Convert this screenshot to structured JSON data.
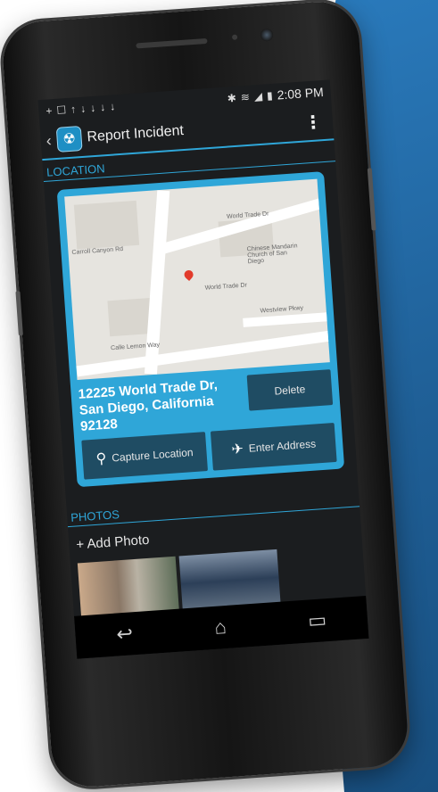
{
  "status_bar": {
    "time": "2:08 PM",
    "notification_icons": [
      "+",
      "☐",
      "↑",
      "↓",
      "↓",
      "↓",
      "↓"
    ],
    "status_icons": [
      "bluetooth-icon",
      "wifi-icon",
      "signal-icon",
      "battery-icon"
    ]
  },
  "action_bar": {
    "back": "‹",
    "app_icon": "☢",
    "title": "Report Incident",
    "menu": "⋮"
  },
  "location": {
    "header": "LOCATION",
    "map_labels": [
      "World Trade Dr",
      "Chinese Mandarin Church of San Diego",
      "World Trade Dr",
      "Carroll Canyon Rd",
      "Calle Lemon Way",
      "Westview Pkwy"
    ],
    "address": "12225 World Trade Dr, San Diego, California 92128",
    "delete_label": "Delete",
    "capture_label": "Capture Location",
    "enter_label": "Enter Address"
  },
  "photos": {
    "header": "PHOTOS",
    "add_label": "+ Add Photo"
  },
  "nav": {
    "back": "↩",
    "home": "⌂",
    "recent": "▭"
  },
  "colors": {
    "accent": "#2fa6d8",
    "button": "#1f4c63",
    "backdrop": "#1f5f96"
  }
}
